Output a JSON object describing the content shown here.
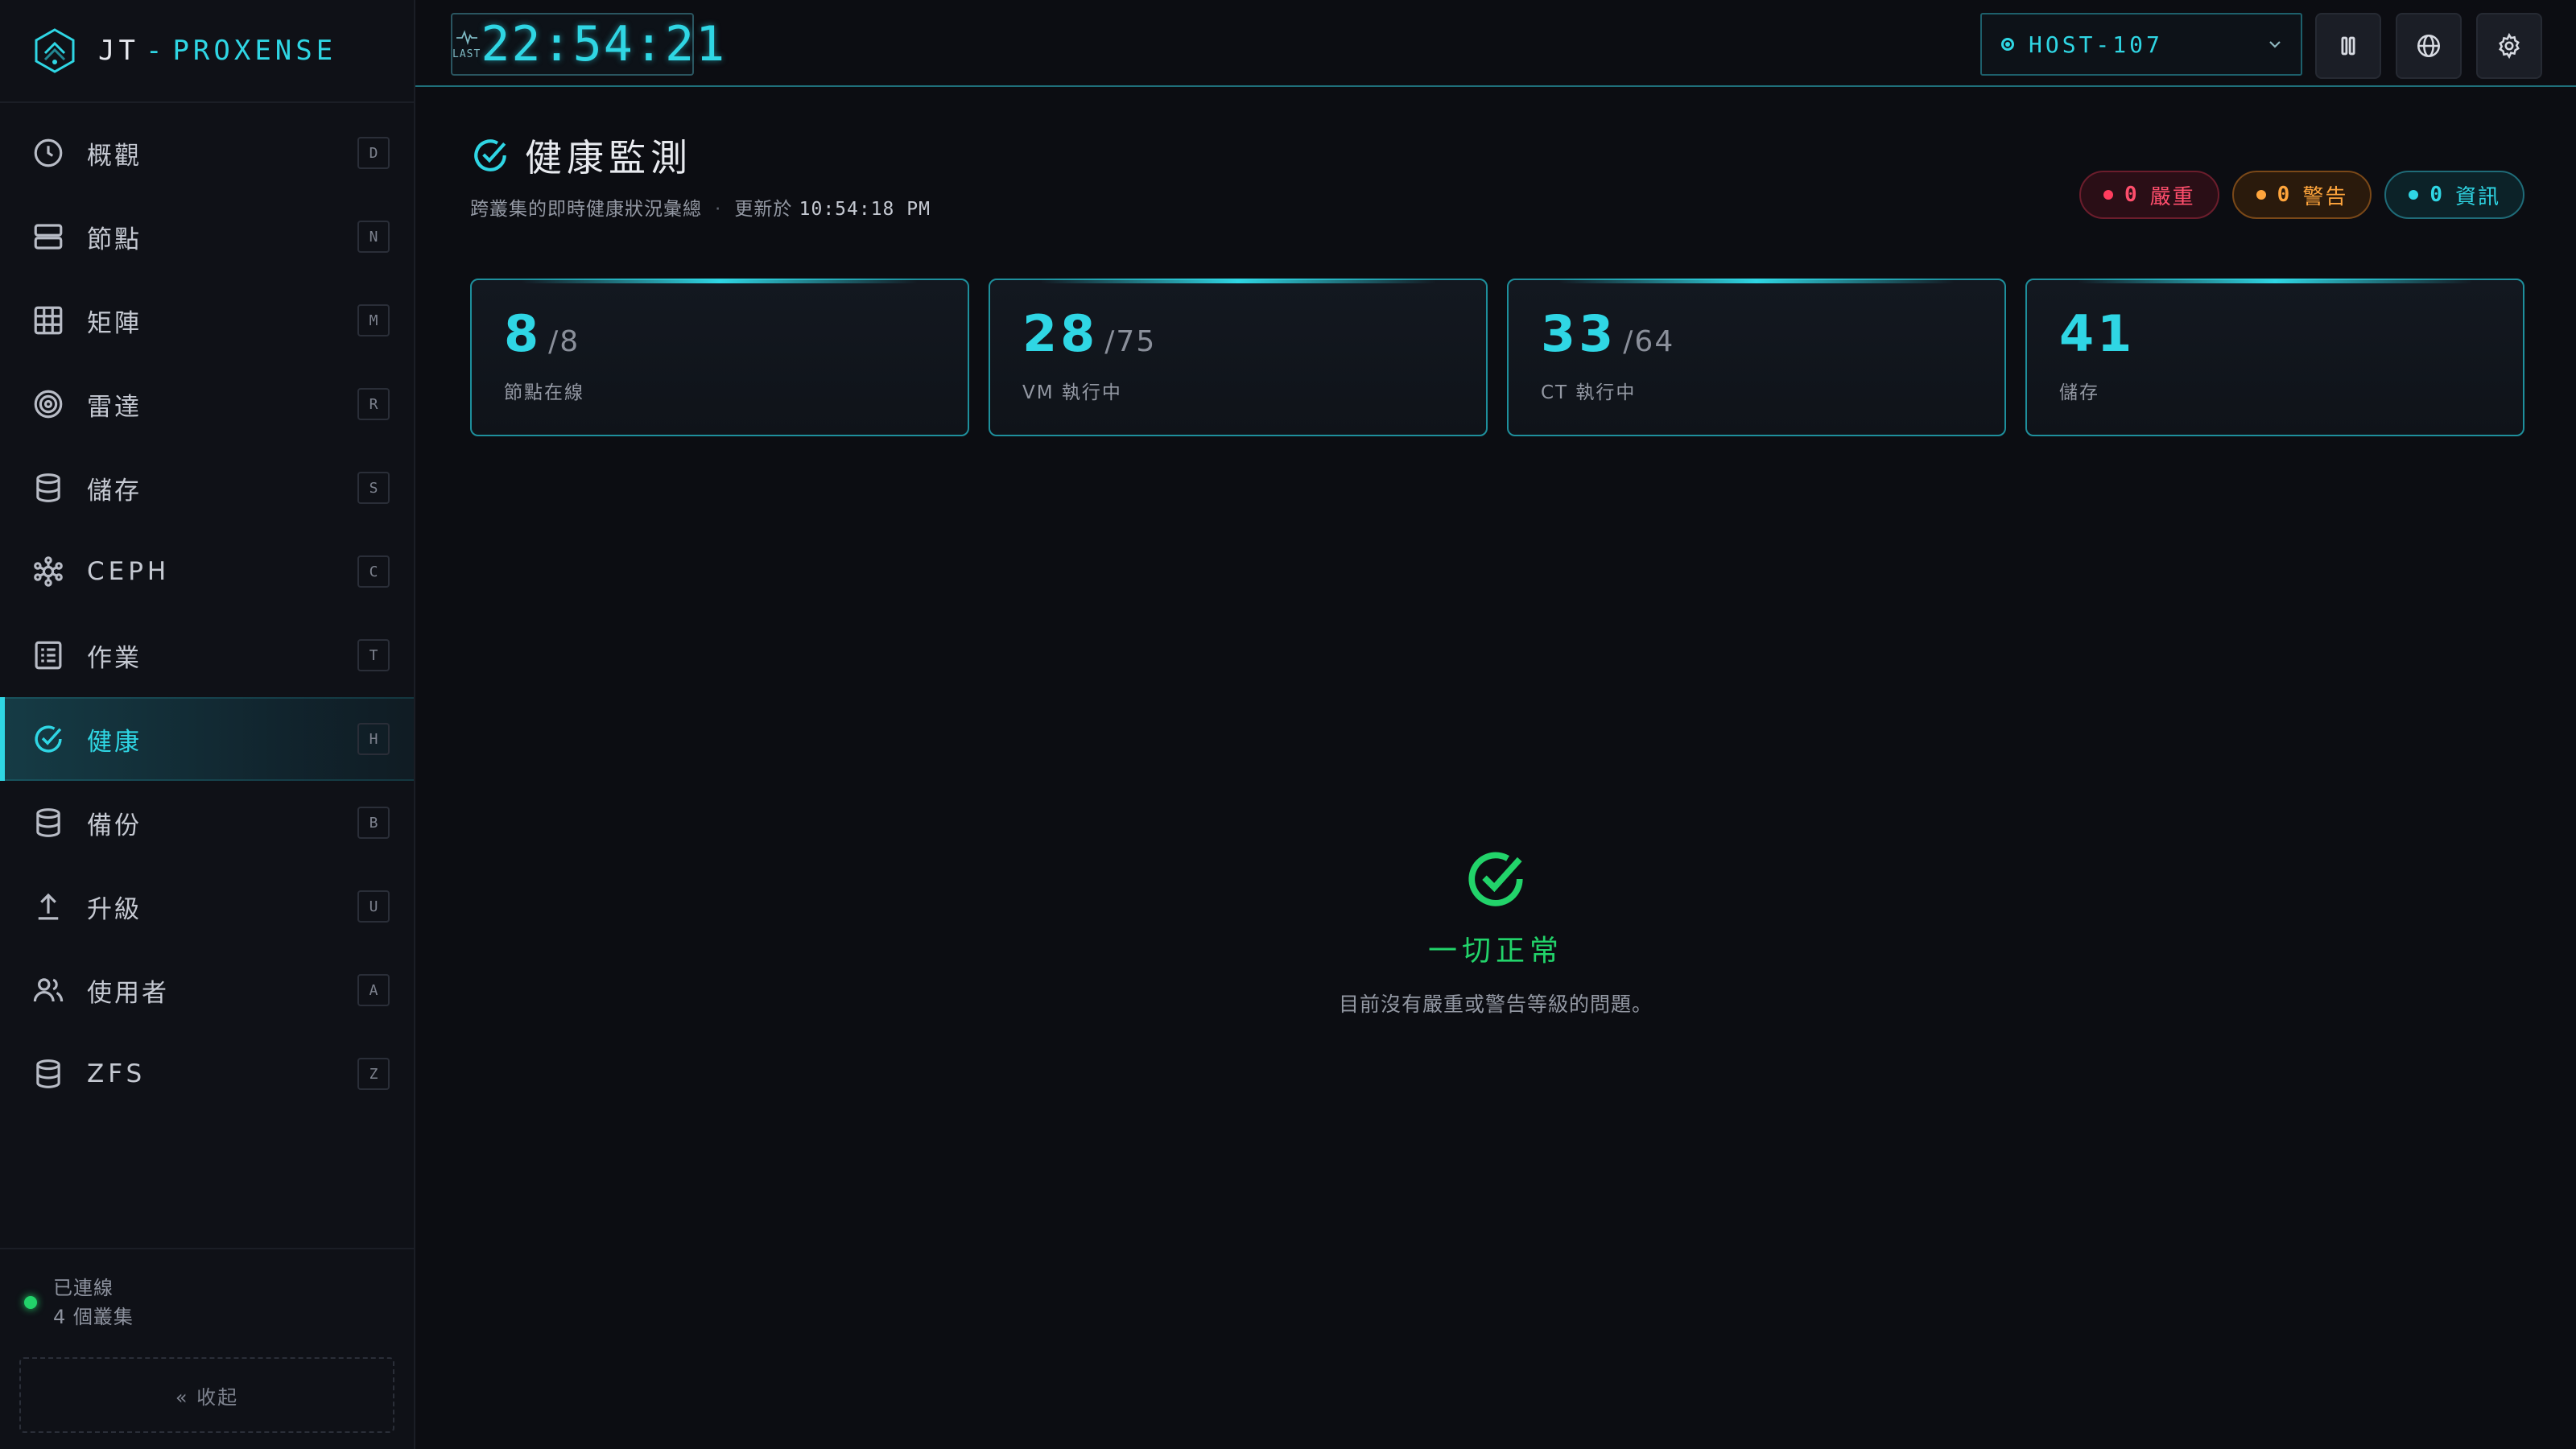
{
  "brand": {
    "prefix": "JT",
    "name": "PROXENSE"
  },
  "clock": {
    "label": "LAST",
    "time": "22:54:21"
  },
  "sidebar": {
    "items": [
      {
        "label": "概觀",
        "key": "D",
        "icon": "clock-icon"
      },
      {
        "label": "節點",
        "key": "N",
        "icon": "server-icon"
      },
      {
        "label": "矩陣",
        "key": "M",
        "icon": "grid-icon"
      },
      {
        "label": "雷達",
        "key": "R",
        "icon": "radar-icon"
      },
      {
        "label": "儲存",
        "key": "S",
        "icon": "database-icon"
      },
      {
        "label": "CEPH",
        "key": "C",
        "icon": "ceph-icon"
      },
      {
        "label": "作業",
        "key": "T",
        "icon": "task-list-icon"
      },
      {
        "label": "健康",
        "key": "H",
        "icon": "health-check-icon",
        "active": true
      },
      {
        "label": "備份",
        "key": "B",
        "icon": "database-icon"
      },
      {
        "label": "升級",
        "key": "U",
        "icon": "upload-icon"
      },
      {
        "label": "使用者",
        "key": "A",
        "icon": "users-icon"
      },
      {
        "label": "ZFS",
        "key": "Z",
        "icon": "database-icon"
      }
    ],
    "status": {
      "connected": "已連線",
      "clusters": "4 個叢集"
    },
    "collapse": "« 收起"
  },
  "header": {
    "host": "HOST-107",
    "buttons": [
      "pause-icon",
      "globe-icon",
      "gear-icon"
    ]
  },
  "page": {
    "title": "健康監測",
    "subtitle": "跨叢集的即時健康狀況彙總",
    "updated_prefix": "更新於",
    "updated_time": "10:54:18 PM",
    "badges": {
      "critical": {
        "count": "0",
        "label": "嚴重"
      },
      "warning": {
        "count": "0",
        "label": "警告"
      },
      "info": {
        "count": "0",
        "label": "資訊"
      }
    },
    "stats": [
      {
        "value": "8",
        "total": "/8",
        "label": "節點在線"
      },
      {
        "value": "28",
        "total": "/75",
        "label": "VM 執行中"
      },
      {
        "value": "33",
        "total": "/64",
        "label": "CT 執行中"
      },
      {
        "value": "41",
        "total": "",
        "label": "儲存"
      }
    ],
    "ok": {
      "title": "一切正常",
      "desc": "目前沒有嚴重或警告等級的問題。"
    }
  },
  "colors": {
    "accent": "#2fd6e4",
    "ok": "#22d36a",
    "critical": "#ff4e6c",
    "warning": "#ffa53c"
  }
}
